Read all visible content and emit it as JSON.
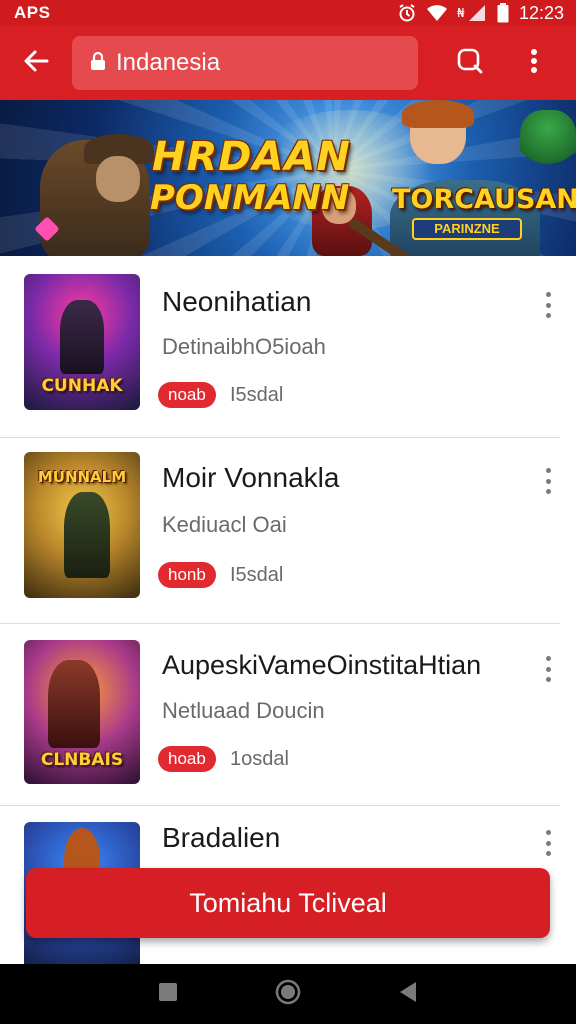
{
  "status_bar": {
    "left_text": "APS",
    "time": "12:23",
    "icons": [
      "alarm-icon",
      "wifi-icon",
      "signal-icon",
      "battery-icon"
    ]
  },
  "app_bar": {
    "back_icon": "arrow-left-icon",
    "search_text": "Indanesia",
    "lock_icon": "lock-icon",
    "search_icon": "search-icon",
    "more_icon": "more-vert-icon"
  },
  "banner": {
    "title_line1": "HRDAAN",
    "title_line2": "PONMANN",
    "badge_title": "TORCAUSAN",
    "badge_sub": "PARINZNE"
  },
  "items": [
    {
      "title": "Neonihatian",
      "subtitle": "DetinaibhO5ioah",
      "tag": "noab",
      "meta": "I5sdal",
      "thumb_text": "CUNHAK"
    },
    {
      "title": "Moir Vonnakla",
      "subtitle": "Kediuacl Oai",
      "tag": "honb",
      "meta": "I5sdal",
      "thumb_text": "MUNNALM"
    },
    {
      "title": "AupeskiVameOinstitaHtian",
      "subtitle": "Netluaad Doucin",
      "tag": "hoab",
      "meta": "1osdal",
      "thumb_text": "CLNBAIS"
    },
    {
      "title": "Bradalien",
      "subtitle": "",
      "tag": "",
      "meta": "",
      "thumb_text": ""
    }
  ],
  "cta": {
    "label": "Tomiahu Tcliveal"
  },
  "nav": {
    "icons": [
      "recents-square-icon",
      "home-circle-icon",
      "back-triangle-icon"
    ]
  },
  "colors": {
    "brand_red": "#d71f24",
    "tag_red": "#e02a2f",
    "text_dark": "#1a1a1a",
    "text_muted": "#6a6a6a"
  }
}
